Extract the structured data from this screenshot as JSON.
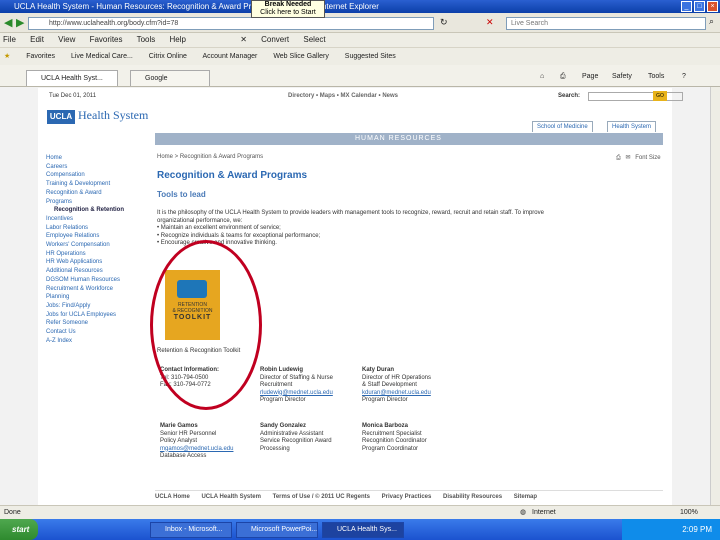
{
  "browser": {
    "window_title": "UCLA Health System - Human Resources: Recognition & Award Programs - Windows Internet Explorer",
    "tooltip_title": "Break Needed",
    "tooltip_text": "Click here to Start",
    "address": "http://www.uclahealth.org/body.cfm?id=78",
    "search_placeholder": "Live Search",
    "menu": [
      "File",
      "Edit",
      "View",
      "Favorites",
      "Tools",
      "Help"
    ],
    "convert_label": "Convert",
    "select_label": "Select",
    "favorites_label": "Favorites",
    "fav_links": [
      "Live Medical Care...",
      "Citrix Online",
      "Account Manager",
      "Web Slice Gallery",
      "Suggested Sites"
    ],
    "tabs": [
      "UCLA Health Syst...",
      "Google"
    ],
    "tab_tools": [
      "Page",
      "Safety",
      "Tools"
    ],
    "status_text": "Done",
    "zone_text": "Internet",
    "zoom": "100%"
  },
  "site": {
    "date": "Tue Dec 01, 2011",
    "utility_links": "Directory • Maps • MX Calendar • News",
    "search_label": "Search:",
    "search_button": "GO",
    "logo_abbr": "UCLA",
    "logo_name": "Health System",
    "site_tabs": [
      "School of Medicine",
      "Health System"
    ],
    "banner": "HUMAN RESOURCES"
  },
  "nav": {
    "items": [
      "Home",
      "Careers",
      "Compensation",
      "Training & Development",
      "Recognition & Award Programs"
    ],
    "sub_item": "Recognition & Retention",
    "more_items": [
      "Incentives",
      "Labor Relations",
      "Employee Relations",
      "Workers' Compensation",
      "HR Operations",
      "HR Web Applications",
      "Additional Resources",
      "DGSOM Human Resources",
      "Recruitment & Workforce Planning",
      "Jobs: Find/Apply",
      "Jobs for UCLA Employees",
      "Refer Someone",
      "Contact Us",
      "A-Z Index"
    ]
  },
  "main": {
    "breadcrumb": "Home > Recognition & Award Programs",
    "print_label": "Print",
    "font_size_label": "Font Size",
    "title": "Recognition & Award Programs",
    "subtitle": "Tools to lead",
    "intro_1": "It is the philosophy of the UCLA Health System to provide leaders with management tools to recognize, reward, recruit and retain staff. To improve",
    "intro_2": "organizational performance, we:",
    "bullets": [
      "Maintain an excellent environment of service;",
      "Recognize individuals & teams for exceptional performance;",
      "Encourage creative and innovative thinking."
    ],
    "toolkit_word1": "RETENTION",
    "toolkit_word2": "& RECOGNITION",
    "toolkit_big": "TOOLKIT",
    "toolkit_caption": "Retention & Recognition Toolkit"
  },
  "contacts": [
    {
      "name": "Contact Information:",
      "line1": "Tel: 310-794-0500",
      "line2": "Fax: 310-794-0772",
      "email": "",
      "line3": ""
    },
    {
      "name": "Robin Ludewig",
      "line1": "Director of Staffing & Nurse",
      "line2": "Recruitment",
      "email": "rludewig@mednet.ucla.edu",
      "line3": "Program Director"
    },
    {
      "name": "Katy Duran",
      "line1": "Director of HR Operations",
      "line2": "& Staff Development",
      "email": "kduran@mednet.ucla.edu",
      "line3": "Program Director"
    },
    {
      "name": "Marie Gamos",
      "line1": "Senior HR Personnel",
      "line2": "Policy Analyst",
      "email": "mgamos@mednet.ucla.edu",
      "line3": "Database Access"
    },
    {
      "name": "Sandy Gonzalez",
      "line1": "Administrative Assistant",
      "line2": "Service Recognition Award",
      "email": "",
      "line3": "Processing"
    },
    {
      "name": "Monica Barboza",
      "line1": "Recruitment Specialist",
      "line2": "Recognition Coordinator",
      "email": "",
      "line3": "Program Coordinator"
    }
  ],
  "footer": [
    "UCLA Home",
    "UCLA Health System",
    "Terms of Use / © 2011 UC Regents",
    "Privacy Practices",
    "Disability Resources",
    "Sitemap"
  ],
  "taskbar": {
    "start": "start",
    "tasks": [
      "Inbox - Microsoft...",
      "Microsoft PowerPoi...",
      "UCLA Health Sys..."
    ],
    "clock": "2:09 PM"
  },
  "colors": {
    "accent": "#2b68b2",
    "highlight_circle": "#c00020",
    "toolkit": "#e6a620"
  }
}
